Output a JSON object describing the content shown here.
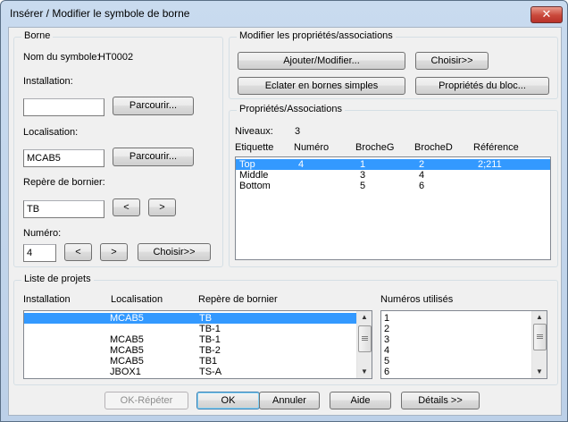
{
  "window": {
    "title": "Insérer / Modifier le symbole de borne",
    "close_glyph": "✕"
  },
  "borne": {
    "legend": "Borne",
    "symbol_label": "Nom du symbole:",
    "symbol_value": "HT0002",
    "installation_label": "Installation:",
    "installation_value": "",
    "browse1": "Parcourir...",
    "localisation_label": "Localisation:",
    "localisation_value": "MCAB5",
    "browse2": "Parcourir...",
    "repere_label": "Repère de bornier:",
    "repere_value": "TB",
    "prev": "<",
    "next": ">",
    "numero_label": "Numéro:",
    "numero_value": "4",
    "num_prev": "<",
    "num_next": ">",
    "choose": "Choisir>>"
  },
  "modifier": {
    "legend": "Modifier les propriétés/associations",
    "add_modify": "Ajouter/Modifier...",
    "choose": "Choisir>>",
    "explode": "Eclater en bornes simples",
    "block_props": "Propriétés du bloc..."
  },
  "props": {
    "legend": "Propriétés/Associations",
    "levels_label": "Niveaux:",
    "levels_value": "3",
    "columns": [
      "Etiquette",
      "Numéro",
      "BrocheG",
      "BrocheD",
      "Référence"
    ],
    "rows": [
      [
        "Top",
        "4",
        "1",
        "2",
        "2;211"
      ],
      [
        "Middle",
        "",
        "3",
        "4",
        ""
      ],
      [
        "Bottom",
        "",
        "5",
        "6",
        ""
      ]
    ],
    "selected": 0
  },
  "projects": {
    "legend": "Liste de projets",
    "columns": [
      "Installation",
      "Localisation",
      "Repère de bornier"
    ],
    "rows": [
      [
        "",
        "MCAB5",
        "TB"
      ],
      [
        "",
        "",
        "TB-1"
      ],
      [
        "",
        "MCAB5",
        "TB-1"
      ],
      [
        "",
        "MCAB5",
        "TB-2"
      ],
      [
        "",
        "MCAB5",
        "TB1"
      ],
      [
        "",
        "JBOX1",
        "TS-A"
      ]
    ],
    "selected": 0,
    "used_label": "Numéros utilisés",
    "used": [
      "1",
      "2",
      "3",
      "4",
      "5",
      "6"
    ]
  },
  "footer": {
    "repeat": "OK-Répéter",
    "ok": "OK",
    "cancel": "Annuler",
    "help": "Aide",
    "details": "Détails >>"
  },
  "icons": {
    "scroll_up": "▲",
    "scroll_down": "▼"
  }
}
